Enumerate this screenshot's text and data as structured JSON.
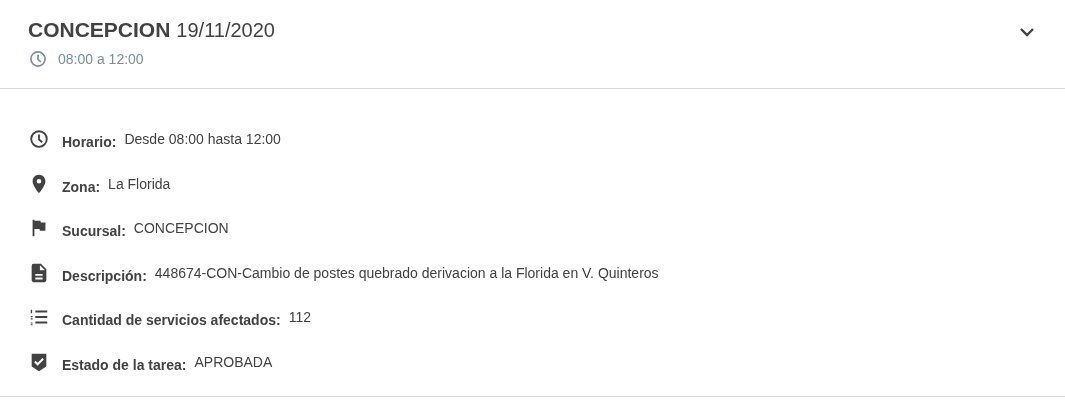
{
  "panel": {
    "title": "CONCEPCION",
    "date": "19/11/2020",
    "time_range": "08:00 a 12:00",
    "expanded": true,
    "details": [
      {
        "kind": "clock",
        "label": "Horario:",
        "value": "Desde 08:00 hasta 12:00"
      },
      {
        "kind": "pin",
        "label": "Zona:",
        "value": "La Florida"
      },
      {
        "kind": "flag",
        "label": "Sucursal:",
        "value": "CONCEPCION"
      },
      {
        "kind": "document",
        "label": "Descripción:",
        "value": "448674-CON-Cambio de postes quebrado derivacion a la Florida en V. Quinteros"
      },
      {
        "kind": "list",
        "label": "Cantidad de servicios afectados:",
        "value": "112"
      },
      {
        "kind": "check",
        "label": "Estado de la tarea:",
        "value": "APROBADA"
      }
    ]
  }
}
